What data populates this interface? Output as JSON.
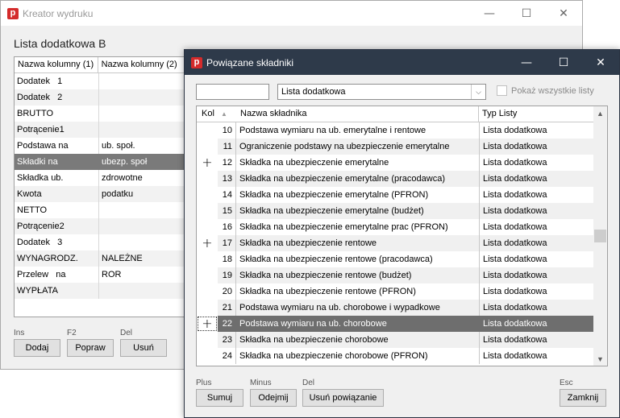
{
  "back_window": {
    "title": "Kreator wydruku",
    "heading": "Lista dodatkowa B",
    "columns": [
      "Nazwa kolumny (1)",
      "Nazwa kolumny (2)"
    ],
    "rows": [
      {
        "c1": "Dodatek   1",
        "c2": ""
      },
      {
        "c1": "Dodatek   2",
        "c2": ""
      },
      {
        "c1": "BRUTTO",
        "c2": ""
      },
      {
        "c1": "Potrącenie1",
        "c2": ""
      },
      {
        "c1": "Podstawa na",
        "c2": "ub. społ."
      },
      {
        "c1": "Składki na",
        "c2": "ubezp. społ"
      },
      {
        "c1": "Składka ub.",
        "c2": "zdrowotne"
      },
      {
        "c1": "Kwota",
        "c2": "podatku"
      },
      {
        "c1": "NETTO",
        "c2": ""
      },
      {
        "c1": "Potrącenie2",
        "c2": ""
      },
      {
        "c1": "Dodatek   3",
        "c2": ""
      },
      {
        "c1": "WYNAGRODZ.",
        "c2": "NALEŻNE"
      },
      {
        "c1": "Przelew   na",
        "c2": "ROR"
      },
      {
        "c1": "WYPŁATA",
        "c2": ""
      }
    ],
    "selected_row": 5,
    "keys": {
      "add": "Ins",
      "edit": "F2",
      "delete": "Del"
    },
    "buttons": {
      "add": "Dodaj",
      "edit": "Popraw",
      "delete": "Usuń"
    }
  },
  "dialog": {
    "title": "Powiązane składniki",
    "search_value": "",
    "list_select": "Lista dodatkowa",
    "show_all_label": "Pokaż wszystkie listy",
    "columns": {
      "kol": "Kol",
      "name": "Nazwa składnika",
      "type": "Typ Listy"
    },
    "rows": [
      {
        "plus": "",
        "num": "10",
        "name": "Podstawa wymiaru na ub. emerytalne i rentowe",
        "type": "Lista dodatkowa"
      },
      {
        "plus": "",
        "num": "11",
        "name": "Ograniczenie podstawy na ubezpieczenie emerytalne",
        "type": "Lista dodatkowa"
      },
      {
        "plus": "+",
        "num": "12",
        "name": "Składka na ubezpieczenie emerytalne",
        "type": "Lista dodatkowa"
      },
      {
        "plus": "",
        "num": "13",
        "name": "Składka na ubezpieczenie emerytalne (pracodawca)",
        "type": "Lista dodatkowa"
      },
      {
        "plus": "",
        "num": "14",
        "name": "Składka na ubezpieczenie emerytalne (PFRON)",
        "type": "Lista dodatkowa"
      },
      {
        "plus": "",
        "num": "15",
        "name": "Składka na ubezpieczenie emerytalne (budżet)",
        "type": "Lista dodatkowa"
      },
      {
        "plus": "",
        "num": "16",
        "name": "Składka na ubezpieczenie emerytalne prac (PFRON)",
        "type": "Lista dodatkowa"
      },
      {
        "plus": "+",
        "num": "17",
        "name": "Składka na ubezpieczenie rentowe",
        "type": "Lista dodatkowa"
      },
      {
        "plus": "",
        "num": "18",
        "name": "Składka na ubezpieczenie rentowe (pracodawca)",
        "type": "Lista dodatkowa"
      },
      {
        "plus": "",
        "num": "19",
        "name": "Składka na ubezpieczenie rentowe (budżet)",
        "type": "Lista dodatkowa"
      },
      {
        "plus": "",
        "num": "20",
        "name": "Składka na ubezpieczenie rentowe (PFRON)",
        "type": "Lista dodatkowa"
      },
      {
        "plus": "",
        "num": "21",
        "name": "Podstawa wymiaru na ub. chorobowe i wypadkowe",
        "type": "Lista dodatkowa"
      },
      {
        "plus": "+",
        "num": "22",
        "name": "Podstawa wymiaru na ub. chorobowe",
        "type": "Lista dodatkowa"
      },
      {
        "plus": "",
        "num": "23",
        "name": "Składka na ubezpieczenie chorobowe",
        "type": "Lista dodatkowa"
      },
      {
        "plus": "",
        "num": "24",
        "name": "Składka na ubezpieczenie chorobowe (PFRON)",
        "type": "Lista dodatkowa"
      }
    ],
    "selected_row": 12,
    "keys": {
      "sum": "Plus",
      "sub": "Minus",
      "remove": "Del",
      "close": "Esc"
    },
    "buttons": {
      "sum": "Sumuj",
      "sub": "Odejmij",
      "remove": "Usuń powiązanie",
      "close": "Zamknij"
    }
  }
}
